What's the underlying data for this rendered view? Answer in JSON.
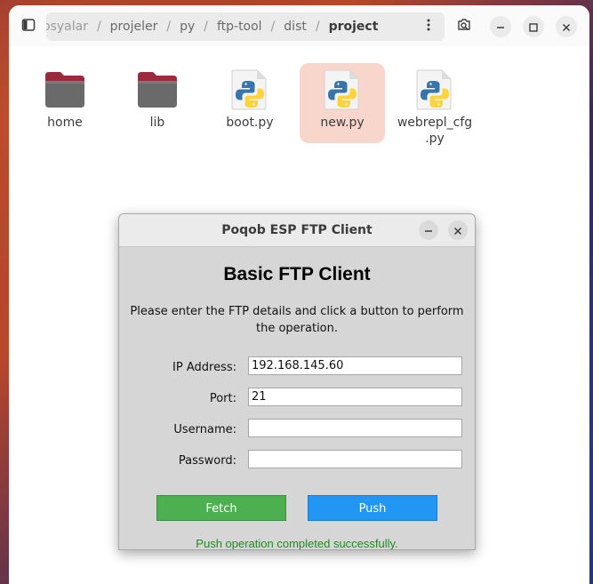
{
  "file_manager": {
    "breadcrumb": [
      "osyalar",
      "projeler",
      "py",
      "ftp-tool",
      "dist",
      "project"
    ],
    "items": [
      {
        "label": "home",
        "kind": "folder-icon"
      },
      {
        "label": "lib",
        "kind": "folder-icon"
      },
      {
        "label": "boot.py",
        "kind": "python-file-icon"
      },
      {
        "label": "new.py",
        "kind": "python-file-icon",
        "selected": true
      },
      {
        "label": "webrepl_cfg\n.py",
        "kind": "python-file-icon"
      }
    ]
  },
  "dialog": {
    "title": "Poqob ESP FTP Client",
    "heading": "Basic FTP Client",
    "instructions": "Please enter the FTP details and click a button to perform the operation.",
    "fields": [
      {
        "label": "IP Address:",
        "value": "192.168.145.60"
      },
      {
        "label": "Port:",
        "value": "21"
      },
      {
        "label": "Username:",
        "value": ""
      },
      {
        "label": "Password:",
        "value": ""
      }
    ],
    "fetch_label": "Fetch",
    "push_label": "Push",
    "status": "Push operation completed successfully."
  },
  "colors": {
    "fetch": "#4caf50",
    "push": "#2196f3",
    "status": "#1f8a1f",
    "selection": "#f9d6cc"
  }
}
